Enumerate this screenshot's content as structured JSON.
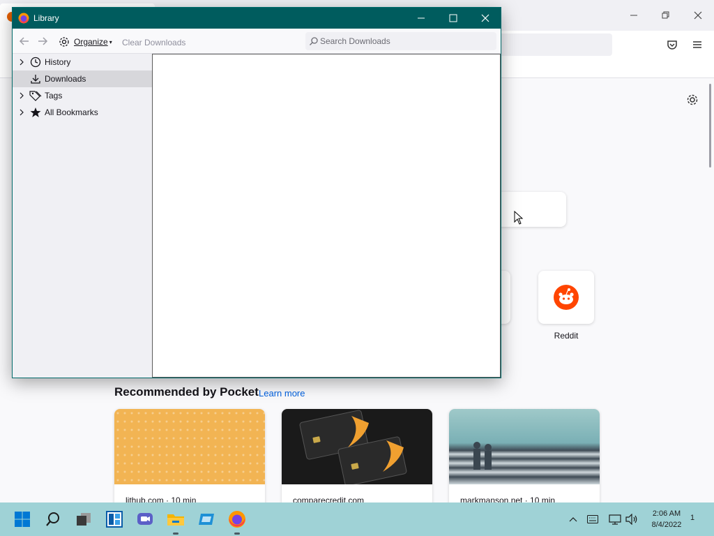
{
  "firefox": {
    "shortcuts": [
      {
        "label": "Reddit",
        "icon": "reddit-icon",
        "color": "#ff4500"
      }
    ],
    "pocket": {
      "heading": "Recommended by Pocket",
      "learn_more": "Learn more",
      "cards": [
        {
          "source": "lithub.com · 10 min"
        },
        {
          "source": "comparecredit.com"
        },
        {
          "source": "markmanson.net · 10 min"
        }
      ]
    }
  },
  "library": {
    "title": "Library",
    "toolbar": {
      "organize_label": "Organize",
      "clear_downloads_label": "Clear Downloads",
      "search_placeholder": "Search Downloads",
      "search_value": ""
    },
    "sidebar": {
      "items": [
        {
          "label": "History",
          "icon": "clock-icon",
          "expandable": true,
          "selected": false
        },
        {
          "label": "Downloads",
          "icon": "download-icon",
          "expandable": false,
          "selected": true
        },
        {
          "label": "Tags",
          "icon": "tags-icon",
          "expandable": true,
          "selected": false
        },
        {
          "label": "All Bookmarks",
          "icon": "star-icon",
          "expandable": true,
          "selected": false
        }
      ]
    }
  },
  "taskbar": {
    "apps": [
      {
        "name": "start",
        "icon": "windows-start-icon"
      },
      {
        "name": "search",
        "icon": "search-icon"
      },
      {
        "name": "task-view",
        "icon": "task-view-icon"
      },
      {
        "name": "widgets",
        "icon": "widgets-icon"
      },
      {
        "name": "teams-chat",
        "icon": "chat-icon"
      },
      {
        "name": "file-explorer",
        "icon": "folder-icon"
      },
      {
        "name": "store",
        "icon": "store-icon"
      },
      {
        "name": "firefox",
        "icon": "firefox-icon"
      }
    ],
    "time": "2:06 AM",
    "date": "8/4/2022",
    "notification_count": "1"
  },
  "colors": {
    "library_titlebar": "#005c5e",
    "taskbar": "#9fd2d6",
    "link": "#0061e0",
    "selected_row": "#d7d7db"
  }
}
